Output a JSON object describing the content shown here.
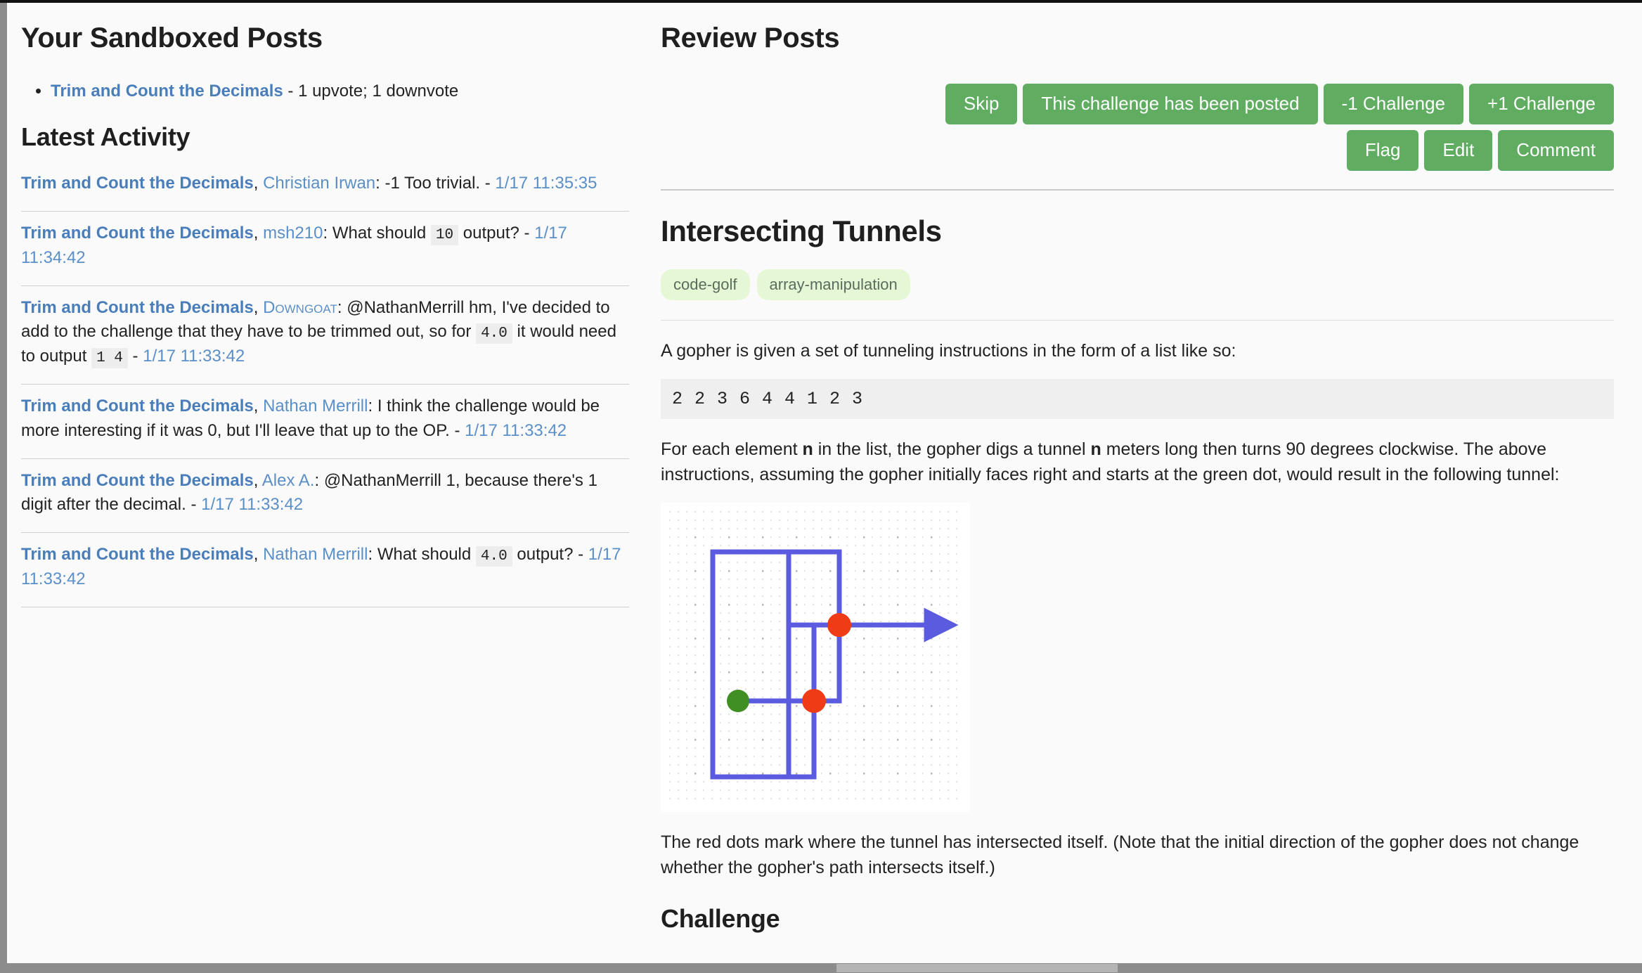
{
  "colors": {
    "accent_green": "#60ad62",
    "link_blue": "#5079b3",
    "tag_bg": "#e6f7d5",
    "tag_text": "#5b6b5e",
    "code_bg": "#ededed",
    "tunnel_path": "#5b5be0",
    "start_dot": "#3f8f22",
    "intersect_dot": "#f03c16"
  },
  "left": {
    "sandboxed_title": "Your Sandboxed Posts",
    "posts": [
      {
        "title": "Trim and Count the Decimals",
        "meta": " - 1 upvote; 1 downvote"
      }
    ],
    "activity_title": "Latest Activity",
    "activity": [
      {
        "post": "Trim and Count the Decimals",
        "sep": ", ",
        "user": "Christian Irwan",
        "user_smallcaps": false,
        "colon": ": ",
        "parts": [
          {
            "type": "text",
            "value": "-1 Too trivial. - "
          }
        ],
        "date": "1/17 11:35:35"
      },
      {
        "post": "Trim and Count the Decimals",
        "sep": ", ",
        "user": "msh210",
        "user_smallcaps": false,
        "colon": ": ",
        "parts": [
          {
            "type": "text",
            "value": "What should "
          },
          {
            "type": "code",
            "value": "10"
          },
          {
            "type": "text",
            "value": " output? - "
          }
        ],
        "date": "1/17 11:34:42"
      },
      {
        "post": "Trim and Count the Decimals",
        "sep": ", ",
        "user": "Downgoat",
        "user_smallcaps": true,
        "colon": ": ",
        "parts": [
          {
            "type": "text",
            "value": "@NathanMerrill hm, I've decided to add to the challenge that they have to be trimmed out, so for "
          },
          {
            "type": "code",
            "value": "4.0"
          },
          {
            "type": "text",
            "value": " it would need to output "
          },
          {
            "type": "code",
            "value": "1 4"
          },
          {
            "type": "text",
            "value": " - "
          }
        ],
        "date": "1/17 11:33:42"
      },
      {
        "post": "Trim and Count the Decimals",
        "sep": ", ",
        "user": "Nathan Merrill",
        "user_smallcaps": false,
        "colon": ": ",
        "parts": [
          {
            "type": "text",
            "value": "I think the challenge would be more interesting if it was 0, but I'll leave that up to the OP. - "
          }
        ],
        "date": "1/17 11:33:42"
      },
      {
        "post": "Trim and Count the Decimals",
        "sep": ", ",
        "user": "Alex A.",
        "user_smallcaps": false,
        "colon": ": ",
        "parts": [
          {
            "type": "text",
            "value": "@NathanMerrill 1, because there's 1 digit after the decimal. - "
          }
        ],
        "date": "1/17 11:33:42"
      },
      {
        "post": "Trim and Count the Decimals",
        "sep": ", ",
        "user": "Nathan Merrill",
        "user_smallcaps": false,
        "colon": ": ",
        "parts": [
          {
            "type": "text",
            "value": "What should "
          },
          {
            "type": "code",
            "value": "4.0"
          },
          {
            "type": "text",
            "value": " output? - "
          }
        ],
        "date": "1/17 11:33:42"
      }
    ]
  },
  "right": {
    "panel_title": "Review Posts",
    "buttons_row1": [
      {
        "label": "Skip",
        "name": "skip-button"
      },
      {
        "label": "This challenge has been posted",
        "name": "already-posted-button"
      },
      {
        "label": "-1 Challenge",
        "name": "downvote-challenge-button"
      },
      {
        "label": "+1 Challenge",
        "name": "upvote-challenge-button"
      }
    ],
    "buttons_row2": [
      {
        "label": "Flag",
        "name": "flag-button"
      },
      {
        "label": "Edit",
        "name": "edit-button"
      },
      {
        "label": "Comment",
        "name": "comment-button"
      }
    ],
    "post": {
      "title": "Intersecting Tunnels",
      "tags": [
        "code-golf",
        "array-manipulation"
      ],
      "intro": "A gopher is given a set of tunneling instructions in the form of a list like so:",
      "code_block": "2 2 3 6 4 4 1 2 3",
      "paragraph2": "For each element n in the list, the gopher digs a tunnel n meters long then turns 90 degrees clockwise. The above instructions, assuming the gopher initially faces right and starts at the green dot, would result in the following tunnel:",
      "paragraph2_bold_token": "n",
      "caption": "The red dots mark where the tunnel has intersected itself. (Note that the initial direction of the gopher does not change whether the gopher's path intersects itself.)",
      "challenge_heading": "Challenge"
    }
  },
  "diagram": {
    "alt": "tunnel-path-diagram",
    "instructions": [
      2,
      2,
      3,
      6,
      4,
      4,
      1,
      2,
      3
    ],
    "start_label": "green dot",
    "intersection_count": 2
  }
}
